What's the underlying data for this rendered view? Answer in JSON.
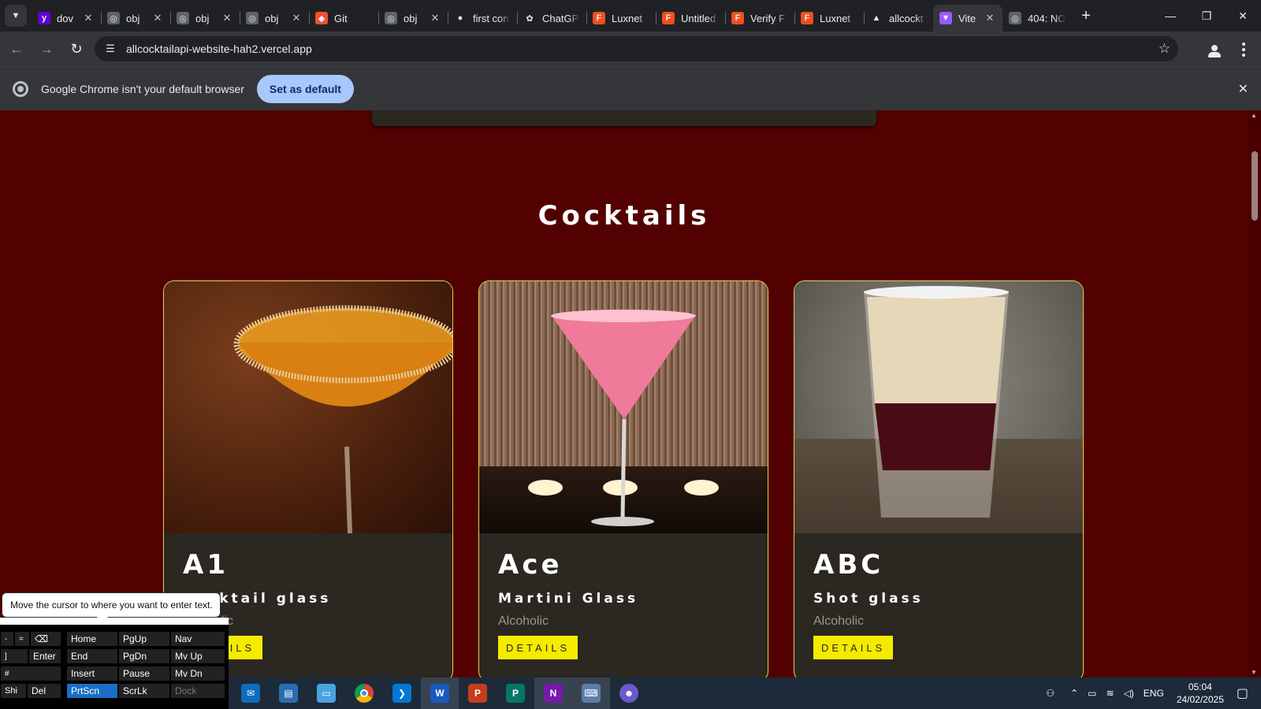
{
  "browser": {
    "tabs": [
      {
        "title": "dov",
        "favicon": "yahoo-icon",
        "color": "#6001d2",
        "glyph": "y"
      },
      {
        "title": "obj",
        "favicon": "globe-icon",
        "color": "#5f6368",
        "glyph": "◎"
      },
      {
        "title": "obj",
        "favicon": "globe-icon",
        "color": "#5f6368",
        "glyph": "◎"
      },
      {
        "title": "obj",
        "favicon": "globe-icon",
        "color": "#5f6368",
        "glyph": "◎"
      },
      {
        "title": "Git",
        "favicon": "git-icon",
        "color": "#f1502f",
        "glyph": "◆"
      },
      {
        "title": "obj",
        "favicon": "globe-icon",
        "color": "#5f6368",
        "glyph": "◎"
      },
      {
        "title": "first con",
        "favicon": "github-icon",
        "color": "#202124",
        "glyph": "●"
      },
      {
        "title": "ChatGP",
        "favicon": "openai-icon",
        "color": "#202124",
        "glyph": "✿"
      },
      {
        "title": "Luxnet",
        "favicon": "figma-icon",
        "color": "#f24e1e",
        "glyph": "F"
      },
      {
        "title": "Untitled",
        "favicon": "figma-icon",
        "color": "#f24e1e",
        "glyph": "F"
      },
      {
        "title": "Verify F",
        "favicon": "figma-icon",
        "color": "#f24e1e",
        "glyph": "F"
      },
      {
        "title": "Luxnet",
        "favicon": "figma-icon",
        "color": "#f24e1e",
        "glyph": "F"
      },
      {
        "title": "allcockt",
        "favicon": "vercel-icon",
        "color": "#202124",
        "glyph": "▲"
      },
      {
        "title": "Vite",
        "favicon": "vite-icon",
        "color": "#9b59ff",
        "glyph": "▼",
        "active": true
      },
      {
        "title": "404: NO",
        "favicon": "globe-icon",
        "color": "#5f6368",
        "glyph": "◎"
      }
    ],
    "url": "allcocktailapi-website-hah2.vercel.app",
    "infobar": {
      "message": "Google Chrome isn't your default browser",
      "button": "Set as default"
    }
  },
  "page": {
    "section_title": "Cocktails",
    "cards": [
      {
        "name": "A1",
        "glass": "Cocktail glass",
        "category": "Alcoholic",
        "button": "DETAILS"
      },
      {
        "name": "Ace",
        "glass": "Martini Glass",
        "category": "Alcoholic",
        "button": "DETAILS"
      },
      {
        "name": "ABC",
        "glass": "Shot glass",
        "category": "Alcoholic",
        "button": "DETAILS"
      }
    ]
  },
  "keyboard": {
    "tooltip": "Move the cursor to where you want to enter text.",
    "keys": [
      "Enter",
      "Home",
      "PgUp",
      "Nav",
      "End",
      "PgDn",
      "Mv Up",
      "Insert",
      "Pause",
      "Mv Dn",
      "PrtScn",
      "ScrLk",
      "Dock",
      "Shi",
      "Del"
    ]
  },
  "taskbar": {
    "language": "ENG",
    "time": "05:04",
    "date": "24/02/2025"
  },
  "colors": {
    "page_bg": "#520000",
    "card_bg": "#2b2721",
    "card_border": "#e6d24a",
    "button_yellow": "#f5ea00"
  }
}
